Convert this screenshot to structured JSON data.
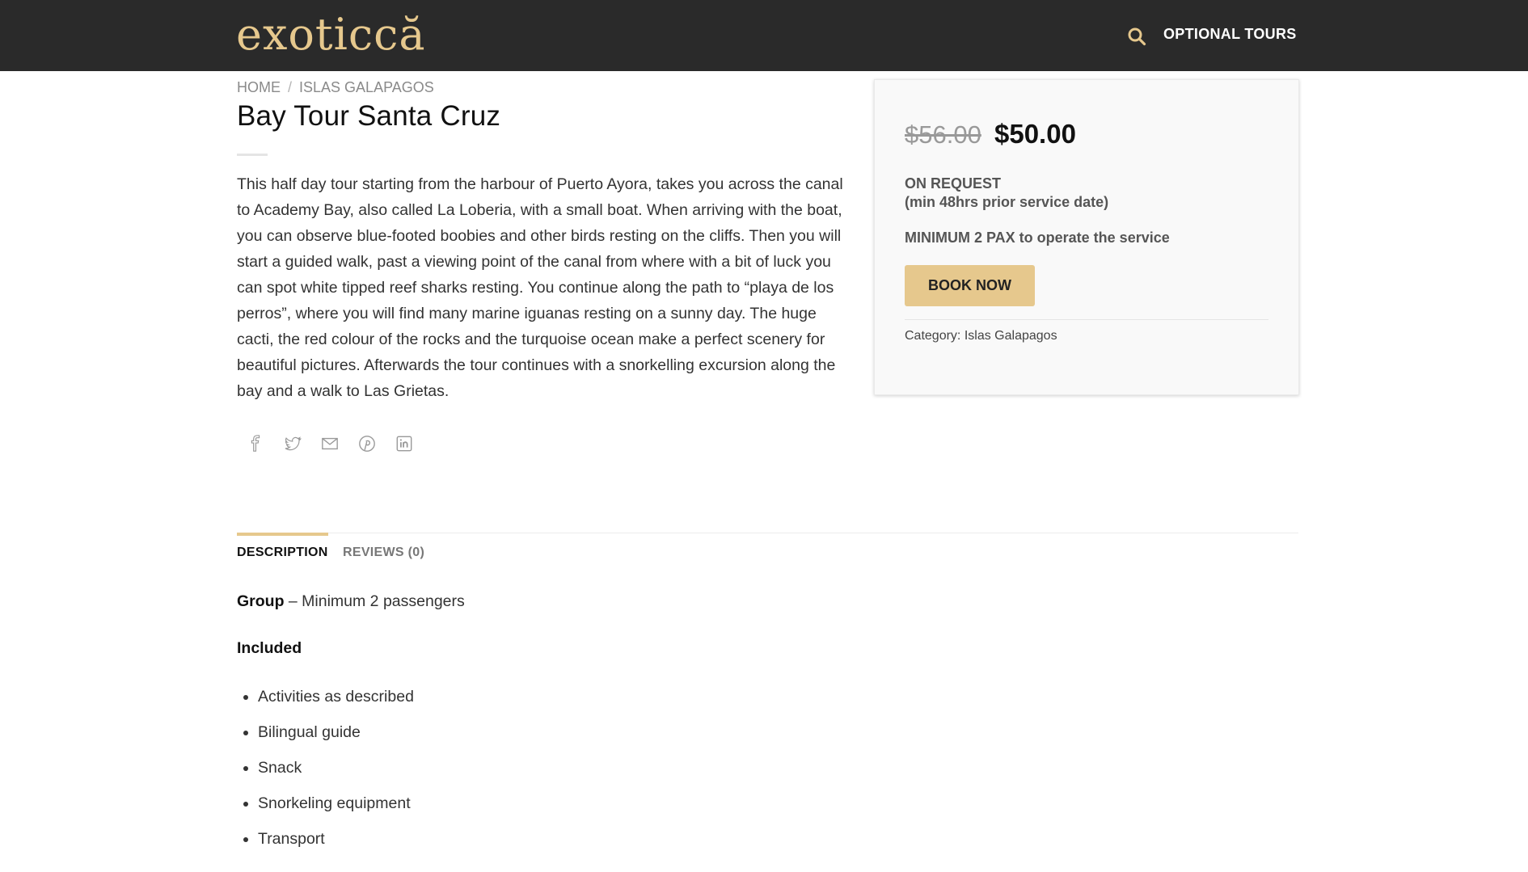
{
  "header": {
    "logo": "exoticcă",
    "search_icon": "search-icon",
    "nav_label": "OPTIONAL TOURS",
    "accent_color": "#e6c88d",
    "bg_color": "#2a2a2a"
  },
  "breadcrumb": {
    "items": [
      "HOME",
      "ISLAS GALAPAGOS"
    ],
    "separator": "/"
  },
  "product": {
    "title": "Bay Tour Santa Cruz",
    "description": "This half day tour starting from the harbour of Puerto Ayora, takes you across the canal to Academy Bay, also called La Loberia, with a small boat. When arriving with the boat, you can observe blue-footed boobies and other birds resting on the cliffs. Then you will start a guided walk, past a viewing point of the canal from where with a bit of luck you can spot white tipped reef sharks resting. You continue along the path to “playa de los perros”, where you will find many marine iguanas resting on a sunny day. The huge cacti, the red colour of the rocks and the turquoise ocean make a perfect scenery for beautiful pictures. Afterwards the tour continues with a snorkelling excursion along the bay and a walk to Las Grietas.",
    "share_icons": [
      "facebook-icon",
      "twitter-icon",
      "email-icon",
      "pinterest-icon",
      "linkedin-icon"
    ]
  },
  "purchase": {
    "old_price": "$56.00",
    "new_price": "$50.00",
    "on_request_line1": "ON REQUEST",
    "on_request_line2": "(min 48hrs prior service date)",
    "min_pax": "MINIMUM 2 PAX to operate the service",
    "book_label": "BOOK NOW",
    "category_label": "Category:",
    "category_value": "Islas Galapagos"
  },
  "tabs": {
    "description_label": "DESCRIPTION",
    "reviews_label": "REVIEWS (0)"
  },
  "details": {
    "group_label": "Group",
    "group_text": " – Minimum 2 passengers",
    "included_title": "Included",
    "included_items": [
      "Activities as described",
      "Bilingual guide",
      "Snack",
      "Snorkeling equipment",
      "Transport"
    ]
  }
}
